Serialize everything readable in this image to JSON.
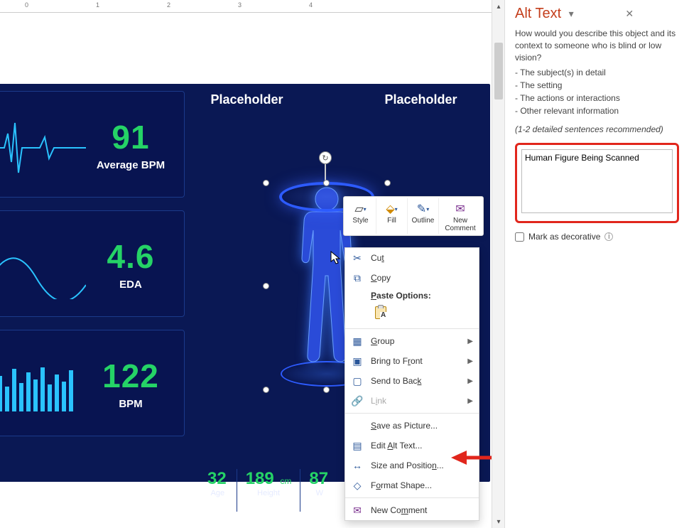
{
  "ruler": {
    "marks": [
      "0",
      "1",
      "2",
      "3",
      "4"
    ]
  },
  "alt_text_pane": {
    "title": "Alt Text",
    "desc": "How would you describe this object and its context to someone who is blind or low vision?",
    "bullets": [
      "- The subject(s) in detail",
      "- The setting",
      "- The actions or interactions",
      "- Other relevant information"
    ],
    "recommended": "(1-2 detailed sentences recommended)",
    "value": "Human Figure Being Scanned",
    "decorative_label": "Mark as decorative",
    "decorative_checked": false
  },
  "slide": {
    "placeholders": [
      "Placeholder",
      "Placeholder"
    ],
    "metrics": [
      {
        "value": "91",
        "label_prefix": "Average ",
        "label_strong": "BPM"
      },
      {
        "value": "4.6",
        "label_prefix": "",
        "label_strong": "EDA"
      },
      {
        "value": "122",
        "label_prefix": "",
        "label_strong": "BPM"
      }
    ],
    "stats": [
      {
        "value": "32",
        "unit": "",
        "label": "Age"
      },
      {
        "value": "189",
        "unit": "cm",
        "label": "Height"
      },
      {
        "value": "87",
        "unit": "",
        "label": "W"
      }
    ],
    "selected_object_name": "Human Figure Being Scanned"
  },
  "mini_toolbar": {
    "style": "Style",
    "fill": "Fill",
    "outline": "Outline",
    "new_comment": "New Comment"
  },
  "context_menu": {
    "cut": "Cut",
    "copy": "Copy",
    "paste_options": "Paste Options:",
    "group": "Group",
    "bring_front": "Bring to Front",
    "send_back": "Send to Back",
    "link": "Link",
    "save_pic": "Save as Picture...",
    "edit_alt": "Edit Alt Text...",
    "size_pos": "Size and Position...",
    "format_shape": "Format Shape...",
    "new_comment": "New Comment"
  }
}
